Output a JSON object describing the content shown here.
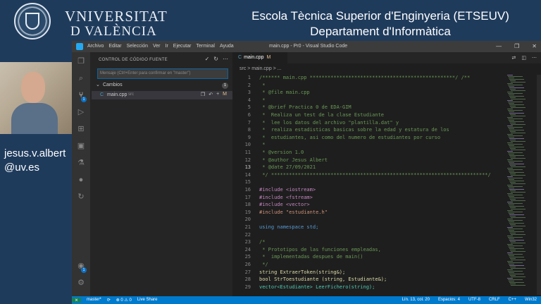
{
  "header": {
    "university_line1": "VNIVERSITAT",
    "university_line2": "D VALÈNCIA",
    "school": "Escola Tècnica Superior d'Enginyeria (ETSEUV)",
    "department": "Departament d'Informàtica"
  },
  "presenter": {
    "contact_line1": "jesus.v.albert",
    "contact_line2": "@uv.es"
  },
  "window": {
    "menu": [
      "Archivo",
      "Editar",
      "Selección",
      "Ver",
      "Ir",
      "Ejecutar",
      "Terminal",
      "Ayuda"
    ],
    "title": "main.cpp - Pr0 - Visual Studio Code",
    "controls": [
      "—",
      "❐",
      "✕"
    ]
  },
  "activity_bar": {
    "icons": [
      "files-icon",
      "search-icon",
      "source-control-icon",
      "run-debug-icon",
      "extensions-icon",
      "remote-explorer-icon",
      "testing-icon",
      "github-icon",
      "live-share-icon",
      "accounts-icon",
      "settings-icon"
    ],
    "source_control_badge": "1",
    "accounts_badge": "1"
  },
  "sidebar": {
    "title": "CONTROL DE CÓDIGO FUENTE",
    "header_icons": [
      "✓",
      "↻",
      "⋯"
    ],
    "message_placeholder": "Mensaje (Ctrl+Enter para confirmar en \"master\")",
    "changes_label": "Cambios",
    "changes_count": "1",
    "file": {
      "name": "main.cpp",
      "dir": "src",
      "status": "M"
    }
  },
  "editor": {
    "tab_label": "main.cpp",
    "tab_modified": "M",
    "breadcrumb": "src  >  main.cpp  >  ...",
    "active_line": 13,
    "lines": [
      {
        "n": "1",
        "t": "/****** main.cpp *************************************************/ /**",
        "c": "c-com"
      },
      {
        "n": "2",
        "t": " *",
        "c": "c-com"
      },
      {
        "n": "3",
        "t": " * @file main.cpp",
        "c": "c-com"
      },
      {
        "n": "4",
        "t": " *",
        "c": "c-com"
      },
      {
        "n": "5",
        "t": " * @brief Practica 0 de EDA-GIM",
        "c": "c-com"
      },
      {
        "n": "6",
        "t": " *  Realiza un test de la clase Estudiante",
        "c": "c-com"
      },
      {
        "n": "7",
        "t": " *  lee los datos del archivo \"plantilla.dat\" y",
        "c": "c-com"
      },
      {
        "n": "8",
        "t": " *  realiza estadisticas basicas sobre la edad y estatura de los",
        "c": "c-com"
      },
      {
        "n": "9",
        "t": " *  estudiantes, asi como del numero de estudiantes por curso",
        "c": "c-com"
      },
      {
        "n": "10",
        "t": " *",
        "c": "c-com"
      },
      {
        "n": "11",
        "t": " * @version 1.0",
        "c": "c-com"
      },
      {
        "n": "12",
        "t": " * @author Jesus Albert",
        "c": "c-com"
      },
      {
        "n": "13",
        "t": " * @date 27/09/2021",
        "c": "c-com"
      },
      {
        "n": "14",
        "t": " */ *************************************************************************/",
        "c": "c-com"
      },
      {
        "n": "15",
        "t": "",
        "c": "c-def"
      },
      {
        "n": "16",
        "t": "#include <iostream>",
        "c": "c-kw"
      },
      {
        "n": "17",
        "t": "#include <fstream>",
        "c": "c-kw"
      },
      {
        "n": "18",
        "t": "#include <vector>",
        "c": "c-kw"
      },
      {
        "n": "19",
        "t": "#include \"estudiante.h\"",
        "c": "c-str"
      },
      {
        "n": "20",
        "t": "",
        "c": "c-def"
      },
      {
        "n": "21",
        "t": "using namespace std;",
        "c": "c-kw2"
      },
      {
        "n": "22",
        "t": "",
        "c": "c-def"
      },
      {
        "n": "23",
        "t": "/*",
        "c": "c-com"
      },
      {
        "n": "24",
        "t": " * Prototipos de las funciones empleadas,",
        "c": "c-com"
      },
      {
        "n": "25",
        "t": " *  implementadas despues de main()",
        "c": "c-com"
      },
      {
        "n": "26",
        "t": " */",
        "c": "c-com"
      },
      {
        "n": "27",
        "t": "string ExtraerToken(string&);",
        "c": "c-fn"
      },
      {
        "n": "28",
        "t": "bool StrToestudiante (string, Estudiante&);",
        "c": "c-fn"
      },
      {
        "n": "29",
        "t": "vector<Estudiante> LeerFichero(string);",
        "c": "c-type"
      }
    ]
  },
  "statusbar": {
    "left": [
      "master*",
      "⟳",
      "⊗ 0 ⚠ 0",
      "Live Share"
    ],
    "right": [
      "Lín. 13, col. 20",
      "Espacios: 4",
      "UTF-8",
      "CRLF",
      "C++",
      "Win32"
    ]
  }
}
